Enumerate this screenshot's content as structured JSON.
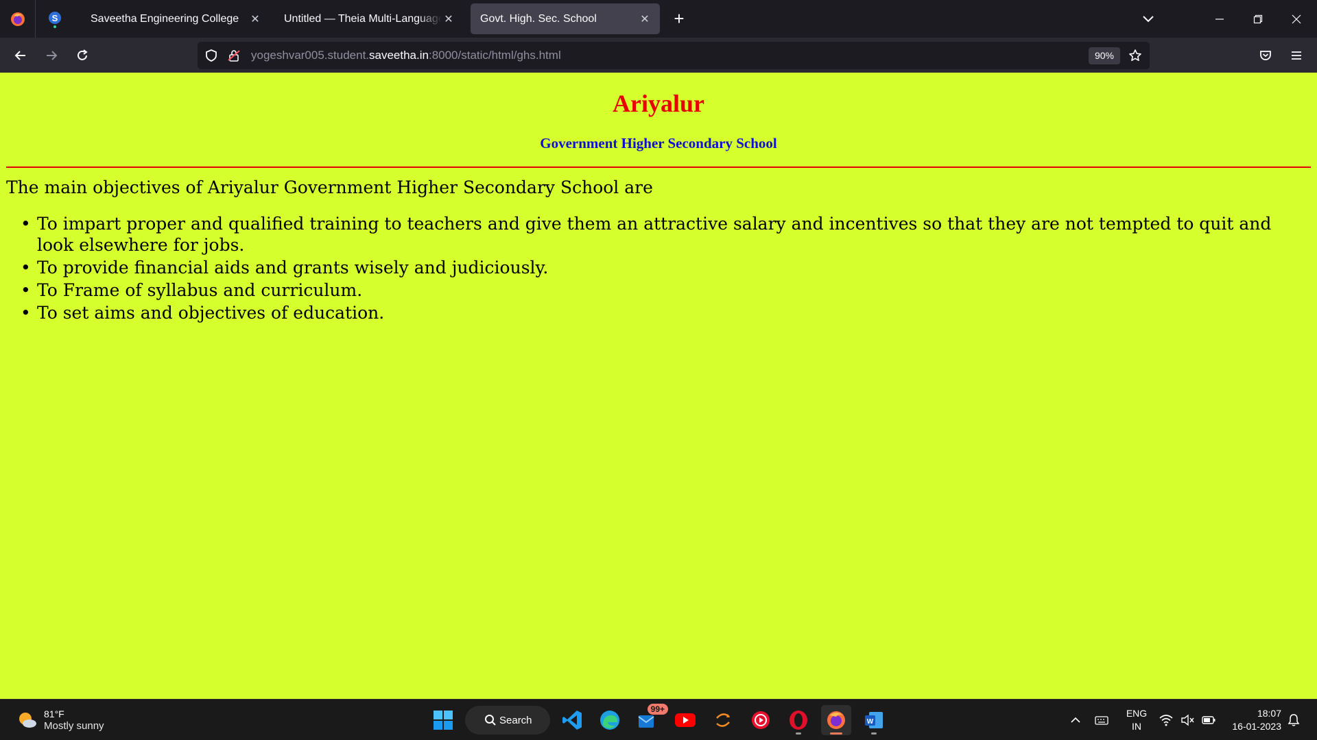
{
  "browser": {
    "tabs": [
      {
        "title": "Saveetha Engineering College",
        "active": false
      },
      {
        "title": "Untitled — Theia Multi-Language Ex",
        "active": false
      },
      {
        "title": "Govt. High. Sec. School",
        "active": true
      }
    ],
    "url_prefix": "yogeshvar005.student.",
    "url_host": "saveetha.in",
    "url_suffix": ":8000/static/html/ghs.html",
    "zoom": "90%"
  },
  "page": {
    "title": "Ariyalur",
    "subtitle": "Government Higher Secondary School",
    "intro": "The main objectives of Ariyalur Government Higher Secondary School are",
    "objectives": [
      "To impart proper and qualified training to teachers and give them an attractive salary and incentives so that they are not tempted to quit and look elsewhere for jobs.",
      "To provide financial aids and grants wisely and judiciously.",
      "To Frame of syllabus and curriculum.",
      "To set aims and objectives of education."
    ],
    "colors": {
      "background": "#d6ff2e",
      "title": "#e80000",
      "subtitle": "#1010d0",
      "rule": "#e00000"
    }
  },
  "taskbar": {
    "weather_temp": "81°F",
    "weather_desc": "Mostly sunny",
    "search_label": "Search",
    "mail_badge": "99+",
    "apps": [
      "windows-start-icon",
      "vscode-icon",
      "edge-icon",
      "mail-icon",
      "youtube-icon",
      "sync-icon",
      "media-player-icon",
      "opera-icon",
      "firefox-icon",
      "word-icon"
    ],
    "lang_line1": "ENG",
    "lang_line2": "IN",
    "time": "18:07",
    "date": "16-01-2023"
  }
}
